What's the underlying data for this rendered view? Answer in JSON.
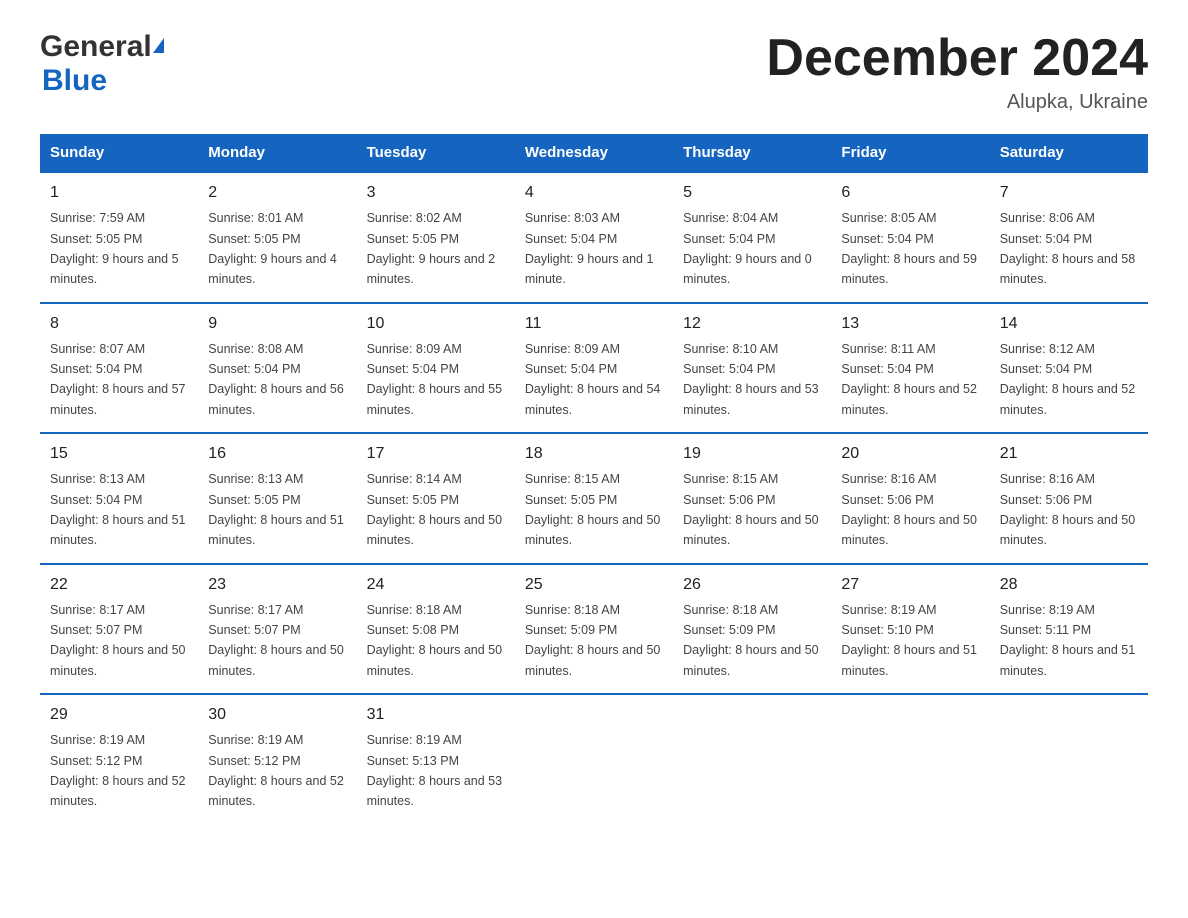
{
  "header": {
    "logo_general": "General",
    "logo_blue": "Blue",
    "month_title": "December 2024",
    "location": "Alupka, Ukraine"
  },
  "columns": [
    "Sunday",
    "Monday",
    "Tuesday",
    "Wednesday",
    "Thursday",
    "Friday",
    "Saturday"
  ],
  "weeks": [
    [
      {
        "day": "1",
        "sunrise": "7:59 AM",
        "sunset": "5:05 PM",
        "daylight": "9 hours and 5 minutes."
      },
      {
        "day": "2",
        "sunrise": "8:01 AM",
        "sunset": "5:05 PM",
        "daylight": "9 hours and 4 minutes."
      },
      {
        "day": "3",
        "sunrise": "8:02 AM",
        "sunset": "5:05 PM",
        "daylight": "9 hours and 2 minutes."
      },
      {
        "day": "4",
        "sunrise": "8:03 AM",
        "sunset": "5:04 PM",
        "daylight": "9 hours and 1 minute."
      },
      {
        "day": "5",
        "sunrise": "8:04 AM",
        "sunset": "5:04 PM",
        "daylight": "9 hours and 0 minutes."
      },
      {
        "day": "6",
        "sunrise": "8:05 AM",
        "sunset": "5:04 PM",
        "daylight": "8 hours and 59 minutes."
      },
      {
        "day": "7",
        "sunrise": "8:06 AM",
        "sunset": "5:04 PM",
        "daylight": "8 hours and 58 minutes."
      }
    ],
    [
      {
        "day": "8",
        "sunrise": "8:07 AM",
        "sunset": "5:04 PM",
        "daylight": "8 hours and 57 minutes."
      },
      {
        "day": "9",
        "sunrise": "8:08 AM",
        "sunset": "5:04 PM",
        "daylight": "8 hours and 56 minutes."
      },
      {
        "day": "10",
        "sunrise": "8:09 AM",
        "sunset": "5:04 PM",
        "daylight": "8 hours and 55 minutes."
      },
      {
        "day": "11",
        "sunrise": "8:09 AM",
        "sunset": "5:04 PM",
        "daylight": "8 hours and 54 minutes."
      },
      {
        "day": "12",
        "sunrise": "8:10 AM",
        "sunset": "5:04 PM",
        "daylight": "8 hours and 53 minutes."
      },
      {
        "day": "13",
        "sunrise": "8:11 AM",
        "sunset": "5:04 PM",
        "daylight": "8 hours and 52 minutes."
      },
      {
        "day": "14",
        "sunrise": "8:12 AM",
        "sunset": "5:04 PM",
        "daylight": "8 hours and 52 minutes."
      }
    ],
    [
      {
        "day": "15",
        "sunrise": "8:13 AM",
        "sunset": "5:04 PM",
        "daylight": "8 hours and 51 minutes."
      },
      {
        "day": "16",
        "sunrise": "8:13 AM",
        "sunset": "5:05 PM",
        "daylight": "8 hours and 51 minutes."
      },
      {
        "day": "17",
        "sunrise": "8:14 AM",
        "sunset": "5:05 PM",
        "daylight": "8 hours and 50 minutes."
      },
      {
        "day": "18",
        "sunrise": "8:15 AM",
        "sunset": "5:05 PM",
        "daylight": "8 hours and 50 minutes."
      },
      {
        "day": "19",
        "sunrise": "8:15 AM",
        "sunset": "5:06 PM",
        "daylight": "8 hours and 50 minutes."
      },
      {
        "day": "20",
        "sunrise": "8:16 AM",
        "sunset": "5:06 PM",
        "daylight": "8 hours and 50 minutes."
      },
      {
        "day": "21",
        "sunrise": "8:16 AM",
        "sunset": "5:06 PM",
        "daylight": "8 hours and 50 minutes."
      }
    ],
    [
      {
        "day": "22",
        "sunrise": "8:17 AM",
        "sunset": "5:07 PM",
        "daylight": "8 hours and 50 minutes."
      },
      {
        "day": "23",
        "sunrise": "8:17 AM",
        "sunset": "5:07 PM",
        "daylight": "8 hours and 50 minutes."
      },
      {
        "day": "24",
        "sunrise": "8:18 AM",
        "sunset": "5:08 PM",
        "daylight": "8 hours and 50 minutes."
      },
      {
        "day": "25",
        "sunrise": "8:18 AM",
        "sunset": "5:09 PM",
        "daylight": "8 hours and 50 minutes."
      },
      {
        "day": "26",
        "sunrise": "8:18 AM",
        "sunset": "5:09 PM",
        "daylight": "8 hours and 50 minutes."
      },
      {
        "day": "27",
        "sunrise": "8:19 AM",
        "sunset": "5:10 PM",
        "daylight": "8 hours and 51 minutes."
      },
      {
        "day": "28",
        "sunrise": "8:19 AM",
        "sunset": "5:11 PM",
        "daylight": "8 hours and 51 minutes."
      }
    ],
    [
      {
        "day": "29",
        "sunrise": "8:19 AM",
        "sunset": "5:12 PM",
        "daylight": "8 hours and 52 minutes."
      },
      {
        "day": "30",
        "sunrise": "8:19 AM",
        "sunset": "5:12 PM",
        "daylight": "8 hours and 52 minutes."
      },
      {
        "day": "31",
        "sunrise": "8:19 AM",
        "sunset": "5:13 PM",
        "daylight": "8 hours and 53 minutes."
      },
      null,
      null,
      null,
      null
    ]
  ],
  "labels": {
    "sunrise": "Sunrise:",
    "sunset": "Sunset:",
    "daylight": "Daylight:"
  }
}
